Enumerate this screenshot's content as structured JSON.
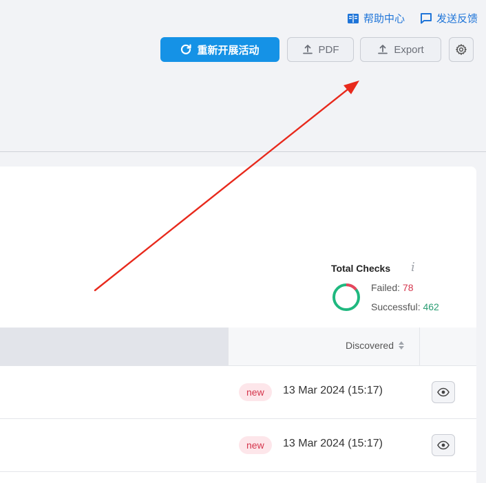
{
  "header": {
    "help_center": "帮助中心",
    "feedback": "发送反馈"
  },
  "toolbar": {
    "restart_label": "重新开展活动",
    "pdf_label": "PDF",
    "export_label": "Export",
    "settings_icon": "gear-icon"
  },
  "total_checks": {
    "title": "Total Checks",
    "info_glyph": "i",
    "failed_label": "Failed:",
    "failed_value": "78",
    "successful_label": "Successful:",
    "successful_value": "462",
    "failed_count": 78,
    "successful_count": 462
  },
  "table": {
    "columns": {
      "discovered": "Discovered"
    },
    "rows": [
      {
        "badge": "new",
        "date": "13 Mar 2024 (15:17)"
      },
      {
        "badge": "new",
        "date": "13 Mar 2024 (15:17)"
      }
    ]
  },
  "colors": {
    "primary": "#1592e6",
    "failed": "#d5354c",
    "success": "#2a9d73",
    "arrow": "#e8291c"
  }
}
